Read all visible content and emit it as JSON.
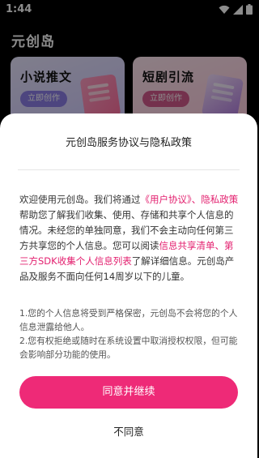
{
  "status_bar": {
    "time": "1:44",
    "icons": [
      "wifi-icon",
      "signal-icon",
      "battery-icon"
    ]
  },
  "app": {
    "title": "元创岛"
  },
  "cards": [
    {
      "title": "小说推文",
      "button": "立即创作",
      "accent": "#8d7ee8"
    },
    {
      "title": "短剧引流",
      "button": "立即创作",
      "accent": "#d45a8d"
    }
  ],
  "dialog": {
    "title": "元创岛服务协议与隐私政策",
    "p1": {
      "t1": "欢迎使用元创岛。我们将通过",
      "link1": "《用户协议》、隐私政策",
      "t2": "帮助您了解我们收集、使用、存储和共享个人信息的情况。未经您的单独同意，我们不会主动向任何第三方共享您的个人信息。您可以阅读",
      "link2": "信息共享清单、第三方SDK收集个人信息列表",
      "t3": "了解详细信息。元创岛产品及服务不面向任何14周岁以下的儿童。"
    },
    "note1": "1.您的个人信息将受到严格保密，元创岛不会将您的个人信息泄露给他人。",
    "note2": "2.您有权拒绝或随时在系统设置中取消授权权限，但可能会影响部分功能的使用。",
    "agree_label": "同意并继续",
    "disagree_label": "不同意",
    "link_color": "#e3206f",
    "button_color": "#ee2a77"
  }
}
